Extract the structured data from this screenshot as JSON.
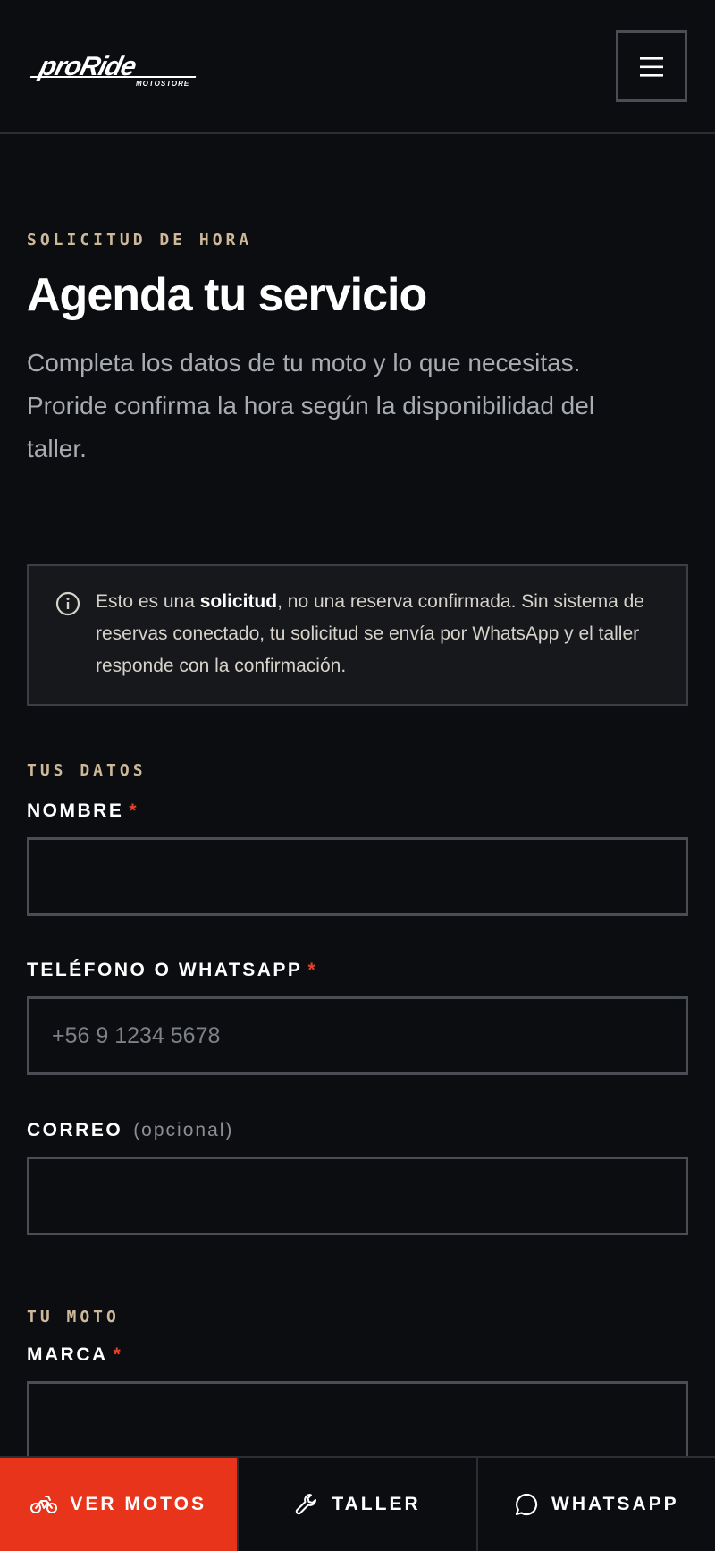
{
  "header": {
    "logo_text": "proRide",
    "logo_sub": "MOTOSTORE",
    "menu_icon": "hamburger-icon"
  },
  "hero": {
    "eyebrow": "SOLICITUD DE HORA",
    "title": "Agenda tu servicio",
    "description": "Completa los datos de tu moto y lo que necesitas. Proride confirma la hora según la disponibilidad del taller."
  },
  "notice": {
    "icon": "info-icon",
    "text_before": "Esto es una ",
    "text_bold": "solicitud",
    "text_after": ", no una reserva confirmada. Sin sistema de reservas conectado, tu solicitud se envía por WhatsApp y el taller responde con la confirmación."
  },
  "form": {
    "section_datos": "TUS DATOS",
    "nombre_label": "NOMBRE",
    "nombre_value": "",
    "telefono_label": "TELÉFONO O WHATSAPP",
    "telefono_placeholder": "+56 9 1234 5678",
    "correo_label": "CORREO",
    "correo_optional": "(opcional)",
    "correo_value": "",
    "section_moto": "TU MOTO",
    "marca_label": "MARCA",
    "marca_value": "",
    "required_mark": "*"
  },
  "bottom_bar": {
    "ver_motos": "VER MOTOS",
    "taller": "TALLER",
    "whatsapp": "WHATSAPP"
  },
  "colors": {
    "background": "#0b0d10",
    "accent": "#e8341a",
    "eyebrow": "#cdb99a",
    "border": "#4a4d53"
  }
}
